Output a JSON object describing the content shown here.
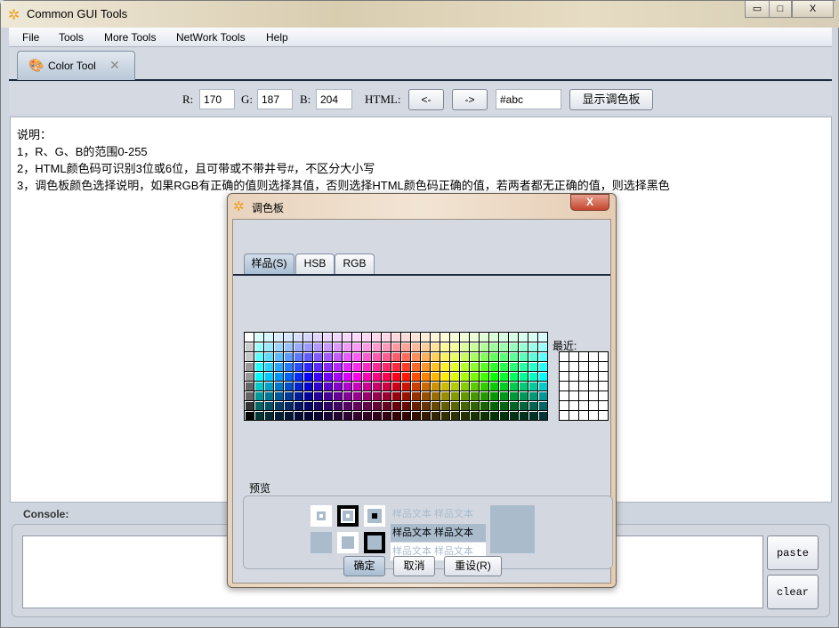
{
  "window": {
    "title": "Common GUI Tools",
    "minimize": "▭",
    "maximize": "□",
    "close": "X"
  },
  "menu": [
    "File",
    "Tools",
    "More Tools",
    "NetWork Tools",
    "Help"
  ],
  "tab": {
    "label": "Color Tool",
    "close": "✕"
  },
  "toolbar": {
    "r_label": "R:",
    "r_value": "170",
    "g_label": "G:",
    "g_value": "187",
    "b_label": "B:",
    "b_value": "204",
    "html_label": "HTML:",
    "left_btn": "<-",
    "right_btn": "->",
    "html_value": "#abc",
    "show_palette": "显示调色板"
  },
  "info": [
    "说明：",
    "1，R、G、B的范围0-255",
    "2，HTML颜色码可识别3位或6位，且可带或不带井号#，不区分大小写",
    "3，调色板颜色选择说明，如果RGB有正确的值则选择其值，否则选择HTML颜色码正确的值，若两者都无正确的值，则选择黑色"
  ],
  "console": {
    "label": "Console:",
    "paste": "paste",
    "clear": "clear"
  },
  "dialog": {
    "title": "调色板",
    "close": "X",
    "tabs": [
      "样品(S)",
      "HSB",
      "RGB"
    ],
    "recent_label": "最近:",
    "preview_label": "预览",
    "sample_text": "样品文本  样品文本",
    "ok": "确定",
    "cancel": "取消",
    "reset": "重设(R)",
    "selected_color": "#aabbcc"
  }
}
